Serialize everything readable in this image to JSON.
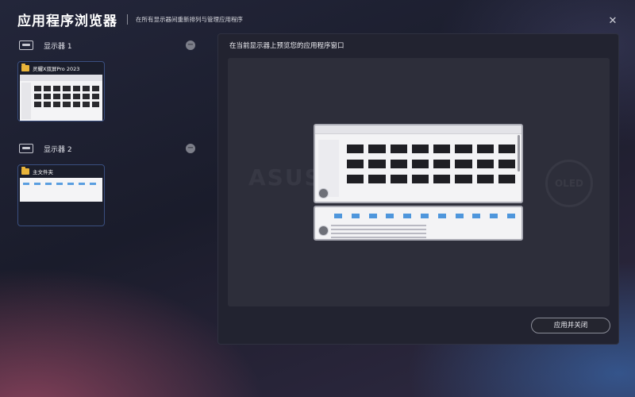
{
  "header": {
    "title": "应用程序浏览器",
    "subtitle": "在所有显示器间重新排列与管理应用程序",
    "close_glyph": "✕"
  },
  "monitors": [
    {
      "label": "显示器 1",
      "collapse_glyph": "−",
      "windows": [
        {
          "label": "灵耀X双屏Pro 2023",
          "icon": "folder-icon"
        }
      ]
    },
    {
      "label": "显示器 2",
      "collapse_glyph": "−",
      "windows": [
        {
          "label": "主文件夹",
          "icon": "folder-icon"
        }
      ]
    }
  ],
  "panel": {
    "title": "在当前显示器上预览您的应用程序窗口",
    "watermark_left": "ASUS",
    "watermark_right": "OLED",
    "apply_label": "应用并关闭"
  },
  "colors": {
    "accent_border": "#3a4f80",
    "folder": "#e9b43a",
    "panel_bg": "#222330"
  }
}
